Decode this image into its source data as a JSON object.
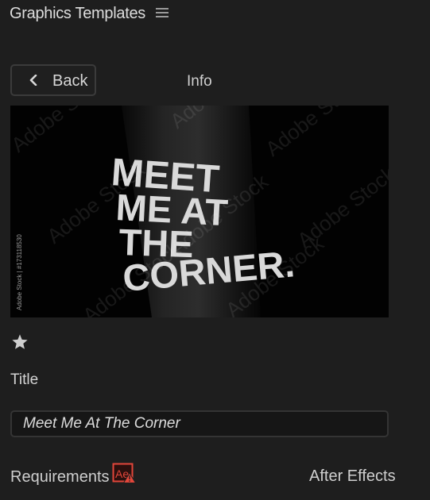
{
  "panel": {
    "title": "Graphics Templates",
    "menu_icon": "hamburger-icon"
  },
  "nav": {
    "back_label": "Back",
    "back_icon": "chevron-left-icon",
    "section_label": "Info"
  },
  "preview": {
    "headline_lines": [
      "MEET",
      "ME AT",
      "THE",
      "CORNER."
    ],
    "watermark_text": "Adobe Stock",
    "stock_id": "Adobe Stock | #173118530"
  },
  "favorite": {
    "icon": "star-icon"
  },
  "fields": {
    "title_label": "Title",
    "title_value": "Meet Me At The Corner"
  },
  "requirements": {
    "label": "Requirements",
    "badge_text": "Ae",
    "badge_icon": "after-effects-warning-icon",
    "value": "After Effects"
  },
  "colors": {
    "background": "#1e1e1e",
    "text": "#d4d4d4",
    "warning": "#e2463a"
  }
}
